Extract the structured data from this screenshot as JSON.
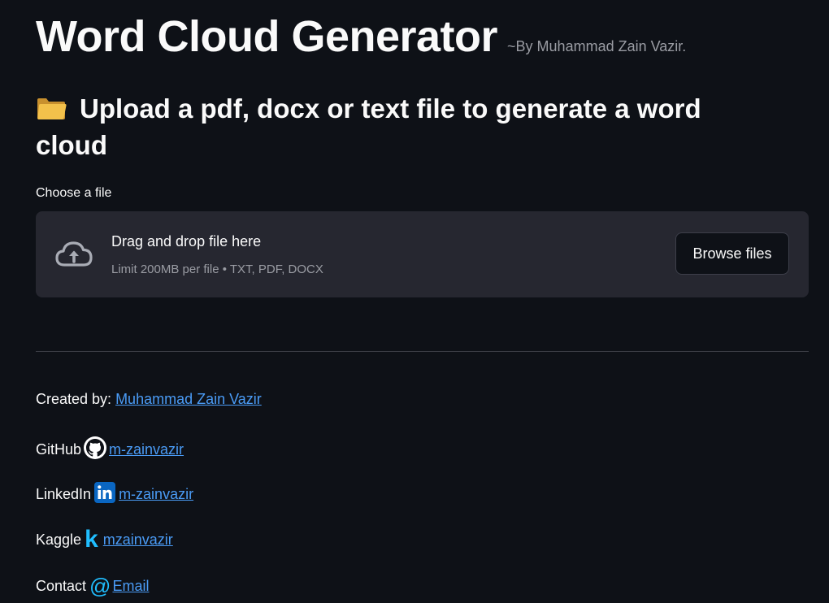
{
  "header": {
    "title": "Word Cloud Generator",
    "byline": "~By Muhammad Zain Vazir."
  },
  "upload": {
    "heading_icon": "folder-icon",
    "heading": "Upload a pdf, docx or text file to generate a word cloud",
    "label": "Choose a file",
    "drop_text": "Drag and drop file here",
    "limit_text": "Limit 200MB per file • TXT, PDF, DOCX",
    "browse_label": "Browse files"
  },
  "footer": {
    "created_prefix": "Created by: ",
    "created_link": "Muhammad Zain Vazir",
    "github_label": "GitHub",
    "github_link": "m-zainvazir",
    "linkedin_label": "LinkedIn",
    "linkedin_link": "m-zainvazir",
    "kaggle_label": "Kaggle",
    "kaggle_icon_text": "k",
    "kaggle_link": "mzainvazir",
    "contact_label": "Contact",
    "contact_icon_text": "@",
    "contact_link": "Email"
  },
  "colors": {
    "background": "#0e1117",
    "dropzone": "#262730",
    "link": "#4a9bf5",
    "muted": "#9a9ca3"
  }
}
